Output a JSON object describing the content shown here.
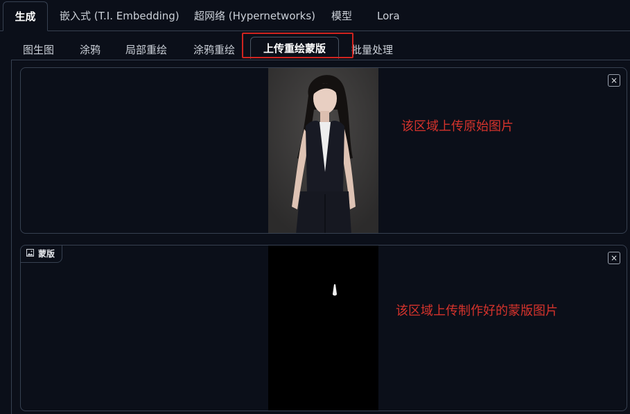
{
  "top_tabs": [
    {
      "label": "生成",
      "active": true
    },
    {
      "label": "嵌入式 (T.I. Embedding)",
      "active": false
    },
    {
      "label": "超网络 (Hypernetworks)",
      "active": false
    },
    {
      "label": "模型",
      "active": false
    },
    {
      "label": "Lora",
      "active": false
    }
  ],
  "sub_tabs": [
    {
      "label": "图生图",
      "active": false
    },
    {
      "label": "涂鸦",
      "active": false
    },
    {
      "label": "局部重绘",
      "active": false
    },
    {
      "label": "涂鸦重绘",
      "active": false
    },
    {
      "label": "上传重绘蒙版",
      "active": true
    },
    {
      "label": "批量处理",
      "active": false
    }
  ],
  "original_upload": {
    "clear_label": "×",
    "annotation": "该区域上传原始图片"
  },
  "mask_upload": {
    "chip_label": "蒙版",
    "clear_label": "×",
    "annotation": "该区域上传制作好的蒙版图片"
  },
  "colors": {
    "background": "#0b0f19",
    "border": "#374151",
    "annotation_red": "#d6332c",
    "highlight_red": "#d0241f"
  }
}
